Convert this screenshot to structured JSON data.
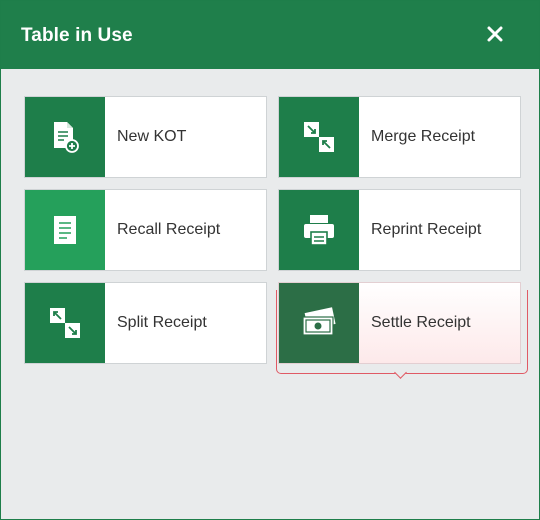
{
  "dialog": {
    "title": "Table in Use"
  },
  "actions": [
    {
      "label": "New KOT",
      "icon": "document-add-icon"
    },
    {
      "label": "Merge Receipt",
      "icon": "merge-icon"
    },
    {
      "label": "Recall Receipt",
      "icon": "receipt-icon"
    },
    {
      "label": "Reprint Receipt",
      "icon": "printer-icon"
    },
    {
      "label": "Split Receipt",
      "icon": "split-icon"
    },
    {
      "label": "Settle Receipt",
      "icon": "cash-icon"
    }
  ],
  "colors": {
    "header": "#1f7f4b",
    "tile_icon": "#1e7e4a",
    "tile_icon_light": "#25a05b",
    "focus_outline": "#e05a65"
  }
}
